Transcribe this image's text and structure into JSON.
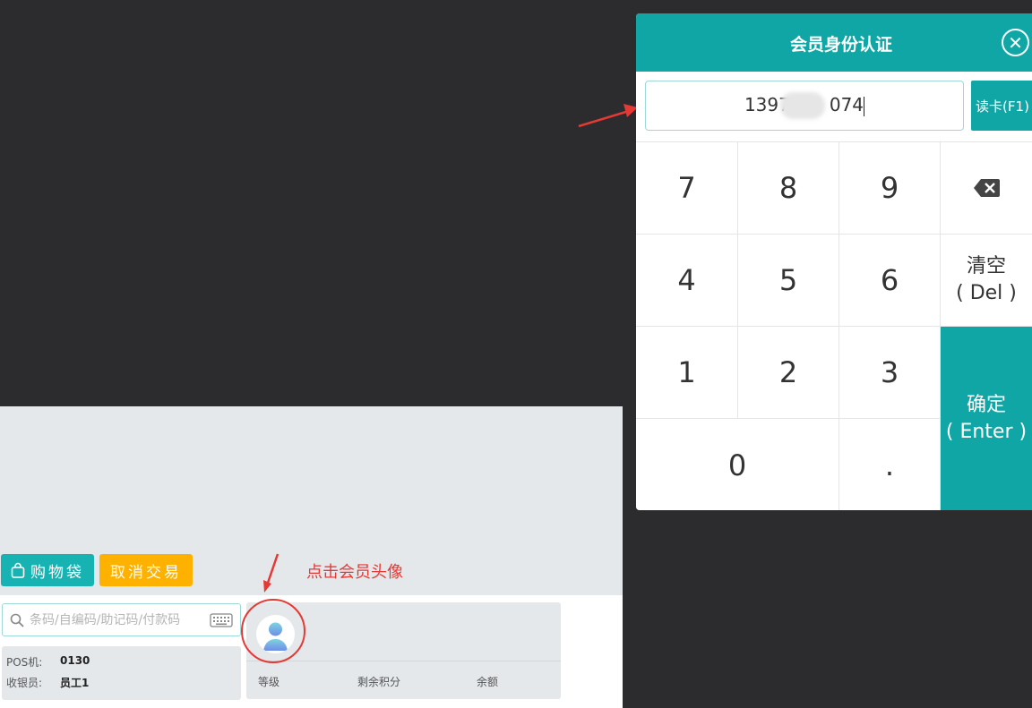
{
  "pos": {
    "bag_button": "购物袋",
    "cancel_button": "取消交易",
    "search_placeholder": "条码/自编码/助记码/付款码",
    "pos_label": "POS机:",
    "pos_value": "0130",
    "cashier_label": "收银员:",
    "cashier_value": "员工1",
    "member_stats": [
      "等级",
      "剩余积分",
      "余额"
    ]
  },
  "annotation": {
    "avatar_hint": "点击会员头像"
  },
  "dialog": {
    "title": "会员身份认证",
    "card_number": "1397",
    "card_number_suffix": "074",
    "read_card_button": "读卡(F1)",
    "keys": [
      "7",
      "8",
      "9",
      "4",
      "5",
      "6",
      "1",
      "2",
      "3",
      "0",
      "."
    ],
    "clear_label": "清空",
    "clear_hint": "( Del )",
    "confirm_label": "确定",
    "confirm_hint": "( Enter )"
  },
  "colors": {
    "primary": "#10a6a6",
    "warning": "#ffb100",
    "annotation": "#e53935",
    "background": "#2c2c2e"
  }
}
